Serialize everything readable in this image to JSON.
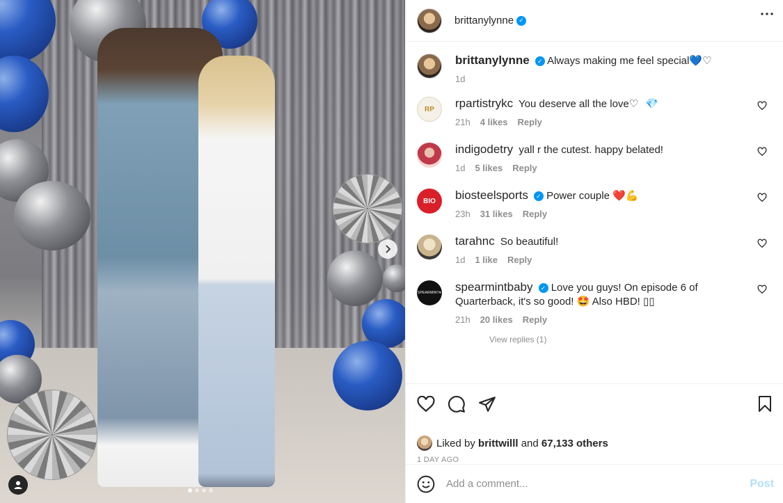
{
  "owner": {
    "username": "brittanylynne",
    "verified": true
  },
  "caption": {
    "username": "brittanylynne",
    "text": "Always making me feel special",
    "emojis": [
      "💙",
      "♡"
    ],
    "time": "1d"
  },
  "comments": [
    {
      "username": "rpartistrykc",
      "avatar_text": "RP",
      "text": "You deserve all the love♡",
      "emoji": "💎",
      "time": "21h",
      "likes": "4 likes",
      "reply": "Reply",
      "verified": false
    },
    {
      "username": "indigodetry",
      "text": "yall r the cutest. happy belated!",
      "time": "1d",
      "likes": "5 likes",
      "reply": "Reply",
      "verified": false
    },
    {
      "username": "biosteelsports",
      "avatar_text": "BIO",
      "text": "Power couple",
      "emoji": "❤️💪",
      "time": "23h",
      "likes": "31 likes",
      "reply": "Reply",
      "verified": true
    },
    {
      "username": "tarahnc",
      "text": "So beautiful!",
      "time": "1d",
      "likes": "1 like",
      "reply": "Reply",
      "verified": false
    },
    {
      "username": "spearmintbaby",
      "avatar_text": "SPEARMINT♥",
      "text": "Love you guys! On episode 6 of Quarterback, it's so good!",
      "emoji": "🤩",
      "text2": "Also HBD! ▯▯",
      "time": "21h",
      "likes": "20 likes",
      "reply": "Reply",
      "verified": true
    }
  ],
  "view_replies": "View replies (1)",
  "liked_by": {
    "prefix": "Liked by",
    "user": "brittwilll",
    "connector": "and",
    "others": "67,133 others"
  },
  "timestamp": "1 DAY AGO",
  "add_comment": {
    "placeholder": "Add a comment...",
    "post_label": "Post"
  },
  "media": {
    "carousel_total": 4,
    "carousel_current": 1
  },
  "icons": {
    "more": "more-horizontal-icon",
    "like": "heart-outline-icon",
    "comment": "comment-bubble-icon",
    "share": "paper-plane-icon",
    "save": "bookmark-icon",
    "emoji": "smiley-icon",
    "tagged": "user-tag-icon",
    "next": "chevron-right-icon"
  },
  "colors": {
    "verified": "#0095f6",
    "post_disabled": "#b2dffc",
    "muted_text": "#8e8e8e"
  }
}
